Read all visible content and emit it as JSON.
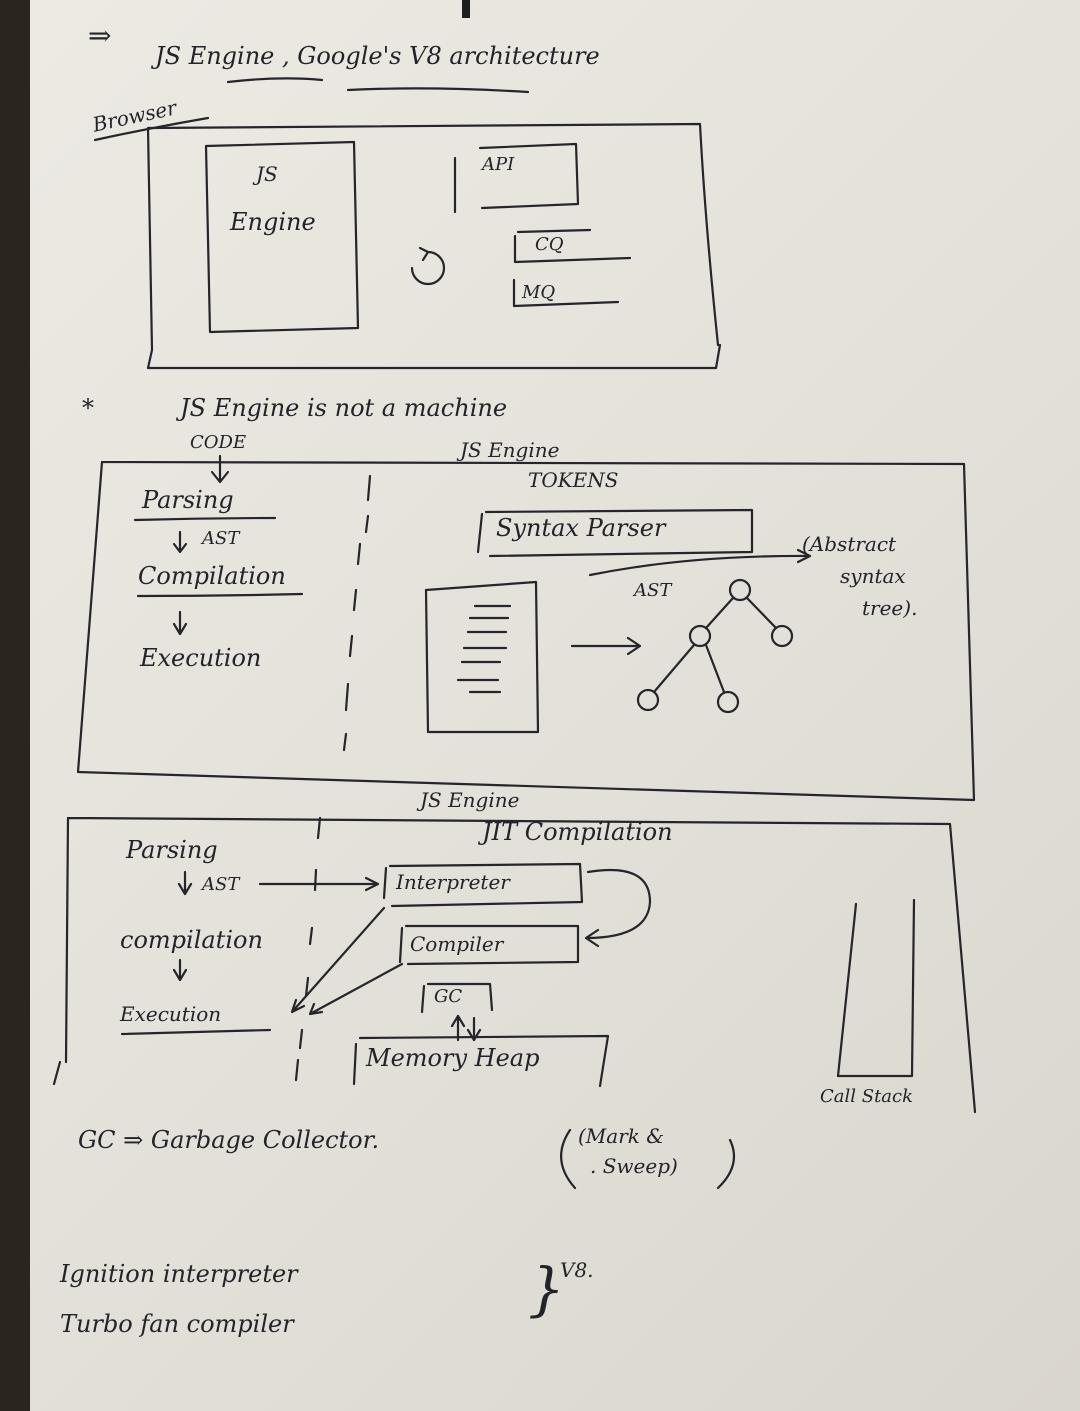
{
  "heading": {
    "arrow": "⇒",
    "text": "JS Engine , Google's V8 architecture"
  },
  "browser": {
    "label": "Browser",
    "js_engine_1": "JS",
    "js_engine_2": "Engine",
    "api": "API",
    "cq": "CQ",
    "mq": "MQ"
  },
  "note": {
    "marker": "*",
    "text": "JS Engine is not a machine"
  },
  "diagram1": {
    "code_label": "CODE",
    "engine_label": "JS Engine",
    "tokens_label": "TOKENS",
    "steps": {
      "parsing": "Parsing",
      "ast": "AST",
      "compilation": "Compilation",
      "execution": "Execution"
    },
    "syntax_parser": "Syntax Parser",
    "ast_label": "AST",
    "ast_note_1": "(Abstract",
    "ast_note_2": "syntax",
    "ast_note_3": "tree)."
  },
  "diagram2": {
    "engine_label": "JS Engine",
    "jit_label": "JIT Compilation",
    "steps": {
      "parsing": "Parsing",
      "ast": "AST",
      "compilation": "compilation",
      "execution": "Execution"
    },
    "interpreter": "Interpreter",
    "compiler": "Compiler",
    "gc": "GC",
    "memory_heap": "Memory Heap",
    "call_stack": "Call Stack"
  },
  "footer": {
    "gc_line": "GC ⇒ Garbage Collector.",
    "gc_note_1": "(Mark &",
    "gc_note_2": ". Sweep)",
    "v8_line_1": "Ignition interpreter",
    "v8_line_2": "Turbo fan compiler",
    "v8_brace": "}",
    "v8_label": "V8."
  }
}
